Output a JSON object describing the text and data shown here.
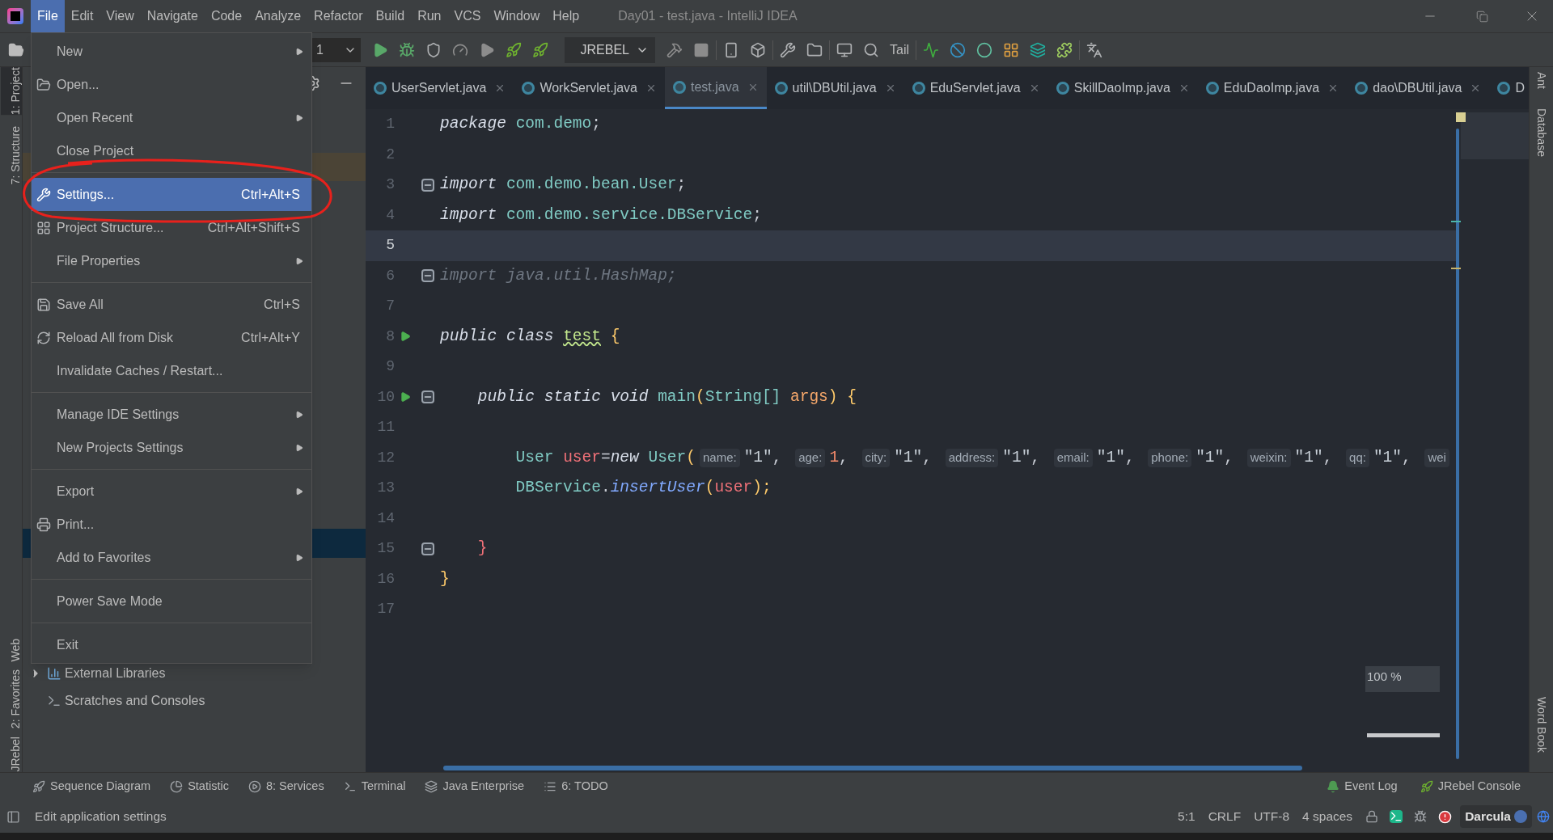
{
  "window": {
    "title": "Day01 - test.java - IntelliJ IDEA"
  },
  "menu_bar": [
    {
      "label": "File",
      "selected": true
    },
    {
      "label": "Edit",
      "selected": false
    },
    {
      "label": "View",
      "selected": false
    },
    {
      "label": "Navigate",
      "selected": false
    },
    {
      "label": "Code",
      "selected": false
    },
    {
      "label": "Analyze",
      "selected": false
    },
    {
      "label": "Refactor",
      "selected": false
    },
    {
      "label": "Build",
      "selected": false
    },
    {
      "label": "Run",
      "selected": false
    },
    {
      "label": "VCS",
      "selected": false
    },
    {
      "label": "Window",
      "selected": false
    },
    {
      "label": "Help",
      "selected": false
    }
  ],
  "toolbar": {
    "config_dropdown": "1",
    "jrebel_dropdown": "JREBEL",
    "tail_label": "Tail"
  },
  "file_menu": [
    {
      "kind": "item",
      "label": "New",
      "submenu": true,
      "selected": false
    },
    {
      "kind": "item",
      "label": "Open...",
      "submenu": false,
      "selected": false
    },
    {
      "kind": "item",
      "label": "Open Recent",
      "submenu": true,
      "selected": false
    },
    {
      "kind": "item",
      "label": "Close Project",
      "submenu": false,
      "selected": false
    },
    {
      "kind": "separator"
    },
    {
      "kind": "item",
      "label": "Settings...",
      "shortcut": "Ctrl+Alt+S",
      "submenu": false,
      "selected": true
    },
    {
      "kind": "item",
      "label": "Project Structure...",
      "shortcut": "Ctrl+Alt+Shift+S",
      "submenu": false,
      "selected": false
    },
    {
      "kind": "item",
      "label": "File Properties",
      "submenu": true,
      "selected": false
    },
    {
      "kind": "separator"
    },
    {
      "kind": "item",
      "label": "Save All",
      "shortcut": "Ctrl+S",
      "submenu": false,
      "selected": false
    },
    {
      "kind": "item",
      "label": "Reload All from Disk",
      "shortcut": "Ctrl+Alt+Y",
      "submenu": false,
      "selected": false
    },
    {
      "kind": "item",
      "label": "Invalidate Caches / Restart...",
      "submenu": false,
      "selected": false
    },
    {
      "kind": "separator"
    },
    {
      "kind": "item",
      "label": "Manage IDE Settings",
      "submenu": true,
      "selected": false
    },
    {
      "kind": "item",
      "label": "New Projects Settings",
      "submenu": true,
      "selected": false
    },
    {
      "kind": "separator"
    },
    {
      "kind": "item",
      "label": "Export",
      "submenu": true,
      "selected": false
    },
    {
      "kind": "item",
      "label": "Print...",
      "submenu": false,
      "selected": false
    },
    {
      "kind": "item",
      "label": "Add to Favorites",
      "submenu": true,
      "selected": false
    },
    {
      "kind": "separator"
    },
    {
      "kind": "item",
      "label": "Power Save Mode",
      "submenu": false,
      "selected": false
    },
    {
      "kind": "separator"
    },
    {
      "kind": "item",
      "label": "Exit",
      "submenu": false,
      "selected": false
    }
  ],
  "left_tool_windows": [
    {
      "label": "1: Project",
      "selected": true
    },
    {
      "label": "7: Structure",
      "selected": false
    },
    {
      "label": "Web",
      "selected": false
    },
    {
      "label": "2: Favorites",
      "selected": false
    },
    {
      "label": "JRebel",
      "selected": false
    }
  ],
  "right_tool_windows": [
    "Ant",
    "Database",
    "Word Book"
  ],
  "project_tree": [
    {
      "label": "External Libraries",
      "expanded": false
    },
    {
      "label": "Scratches and Consoles"
    }
  ],
  "tabs": [
    {
      "label": "UserServlet.java",
      "selected": false
    },
    {
      "label": "WorkServlet.java",
      "selected": false
    },
    {
      "label": "test.java",
      "selected": true
    },
    {
      "label": "util\\DBUtil.java",
      "selected": false
    },
    {
      "label": "EduServlet.java",
      "selected": false
    },
    {
      "label": "SkillDaoImp.java",
      "selected": false
    },
    {
      "label": "EduDaoImp.java",
      "selected": false
    },
    {
      "label": "dao\\DBUtil.java",
      "selected": false
    },
    {
      "label": "D",
      "selected": false
    }
  ],
  "code_lines": [
    {
      "number": "1",
      "current": false,
      "run": false,
      "fold": false,
      "tokens": [
        {
          "text": "package ",
          "kind": "keyword"
        },
        {
          "text": "com.demo",
          "kind": "type"
        },
        {
          "text": ";",
          "kind": "plain"
        }
      ]
    },
    {
      "number": "2",
      "current": false,
      "run": false,
      "fold": false
    },
    {
      "number": "3",
      "current": false,
      "run": false,
      "fold": true,
      "tokens": [
        {
          "text": "import ",
          "kind": "keyword"
        },
        {
          "text": "com.demo.bean.User",
          "kind": "type"
        },
        {
          "text": ";",
          "kind": "plain"
        }
      ]
    },
    {
      "number": "4",
      "current": false,
      "run": false,
      "fold": false,
      "tokens": [
        {
          "text": "import ",
          "kind": "keyword"
        },
        {
          "text": "com.demo.service.DBService",
          "kind": "type"
        },
        {
          "text": ";",
          "kind": "plain"
        }
      ]
    },
    {
      "number": "5",
      "current": true,
      "run": false,
      "fold": false
    },
    {
      "number": "6",
      "current": false,
      "run": false,
      "fold": true,
      "tokens": [
        {
          "text": "import java.util.HashMap;",
          "kind": "unused"
        }
      ]
    },
    {
      "number": "7",
      "current": false,
      "run": false,
      "fold": false
    },
    {
      "number": "8",
      "current": false,
      "run": true,
      "fold": false,
      "tokens": [
        {
          "text": "public class ",
          "kind": "keyword"
        },
        {
          "text": "test",
          "kind": "warning"
        },
        {
          "text": " {",
          "kind": "brace"
        }
      ]
    },
    {
      "number": "9",
      "current": false,
      "run": false,
      "fold": false
    },
    {
      "number": "10",
      "current": false,
      "run": true,
      "fold": true,
      "tokens": [
        {
          "text": "    public static void ",
          "kind": "keyword"
        },
        {
          "text": "main",
          "kind": "type"
        },
        {
          "text": "(",
          "kind": "brace"
        },
        {
          "text": "String[] ",
          "kind": "type"
        },
        {
          "text": "args",
          "kind": "param"
        },
        {
          "text": ") {",
          "kind": "brace"
        }
      ]
    },
    {
      "number": "11",
      "current": false,
      "run": false,
      "fold": false
    },
    {
      "number": "12",
      "current": false,
      "run": false,
      "fold": false,
      "tokens": [
        {
          "text": "        User ",
          "kind": "type"
        },
        {
          "text": "user",
          "kind": "variable"
        },
        {
          "text": "=",
          "kind": "plain"
        },
        {
          "text": "new ",
          "kind": "keyword"
        },
        {
          "text": "User",
          "kind": "type"
        },
        {
          "text": "(",
          "kind": "brace"
        },
        {
          "text": "name:",
          "kind": "hint"
        },
        {
          "text": "\"1\"",
          "kind": "string"
        },
        {
          "text": ", ",
          "kind": "plain"
        },
        {
          "text": "age:",
          "kind": "hint"
        },
        {
          "text": "1",
          "kind": "number"
        },
        {
          "text": ", ",
          "kind": "plain"
        },
        {
          "text": "city:",
          "kind": "hint"
        },
        {
          "text": "\"1\"",
          "kind": "string"
        },
        {
          "text": ", ",
          "kind": "plain"
        },
        {
          "text": "address:",
          "kind": "hint"
        },
        {
          "text": "\"1\"",
          "kind": "string"
        },
        {
          "text": ", ",
          "kind": "plain"
        },
        {
          "text": "email:",
          "kind": "hint"
        },
        {
          "text": "\"1\"",
          "kind": "string"
        },
        {
          "text": ", ",
          "kind": "plain"
        },
        {
          "text": "phone:",
          "kind": "hint"
        },
        {
          "text": "\"1\"",
          "kind": "string"
        },
        {
          "text": ", ",
          "kind": "plain"
        },
        {
          "text": "weixin:",
          "kind": "hint"
        },
        {
          "text": "\"1\"",
          "kind": "string"
        },
        {
          "text": ", ",
          "kind": "plain"
        },
        {
          "text": "qq:",
          "kind": "hint"
        },
        {
          "text": "\"1\"",
          "kind": "string"
        },
        {
          "text": ", ",
          "kind": "plain"
        },
        {
          "text": "wei",
          "kind": "hint"
        }
      ]
    },
    {
      "number": "13",
      "current": false,
      "run": false,
      "fold": false,
      "tokens": [
        {
          "text": "        DBService",
          "kind": "type"
        },
        {
          "text": ".",
          "kind": "plain"
        },
        {
          "text": "insertUser",
          "kind": "method"
        },
        {
          "text": "(",
          "kind": "brace"
        },
        {
          "text": "user",
          "kind": "variable"
        },
        {
          "text": ");",
          "kind": "brace"
        }
      ]
    },
    {
      "number": "14",
      "current": false,
      "run": false,
      "fold": false
    },
    {
      "number": "15",
      "current": false,
      "run": false,
      "fold": true,
      "tokens": [
        {
          "text": "    }",
          "kind": "closing"
        }
      ]
    },
    {
      "number": "16",
      "current": false,
      "run": false,
      "fold": false,
      "tokens": [
        {
          "text": "}",
          "kind": "brace"
        }
      ]
    },
    {
      "number": "17",
      "current": false,
      "run": false,
      "fold": false
    }
  ],
  "zoom_indicator": "100 %",
  "bottom_tool_windows": [
    "Sequence Diagram",
    "Statistic",
    "8: Services",
    "Terminal",
    "Java Enterprise",
    "6: TODO"
  ],
  "bottom_right_tool_windows": [
    "Event Log",
    "JRebel Console"
  ],
  "status_bar": {
    "message": "Edit application settings",
    "position": "5:1",
    "line_separator": "CRLF",
    "encoding": "UTF-8",
    "indent": "4 spaces",
    "theme": "Darcula"
  }
}
